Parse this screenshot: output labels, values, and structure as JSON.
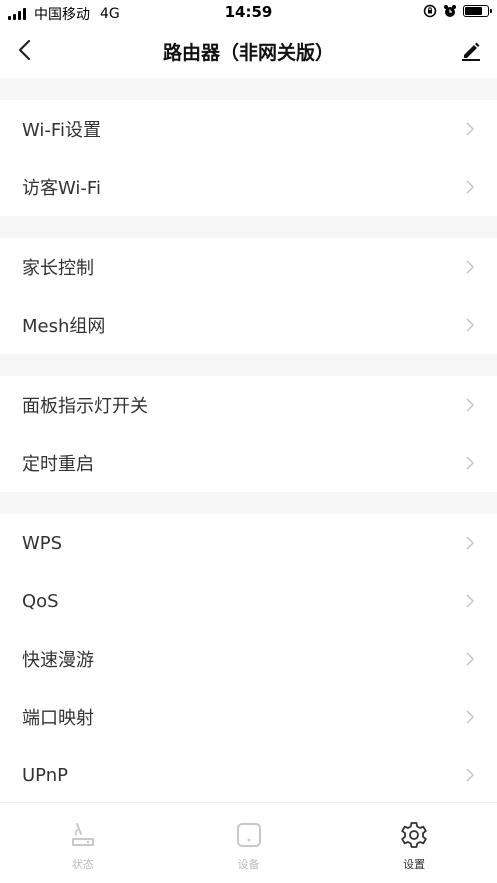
{
  "status_bar": {
    "carrier": "中国移动",
    "network": "4G",
    "time": "14:59"
  },
  "header": {
    "title": "路由器（非网关版）"
  },
  "menu": {
    "group1": [
      "Wi-Fi设置",
      "访客Wi-Fi"
    ],
    "group2": [
      "家长控制",
      "Mesh组网"
    ],
    "group3": [
      "面板指示灯开关",
      "定时重启"
    ],
    "group4": [
      "WPS",
      "QoS",
      "快速漫游",
      "端口映射",
      "UPnP"
    ]
  },
  "tabs": [
    {
      "label": "状态",
      "icon": "router-icon",
      "active": false
    },
    {
      "label": "设备",
      "icon": "device-icon",
      "active": false
    },
    {
      "label": "设置",
      "icon": "gear-icon",
      "active": true
    }
  ]
}
